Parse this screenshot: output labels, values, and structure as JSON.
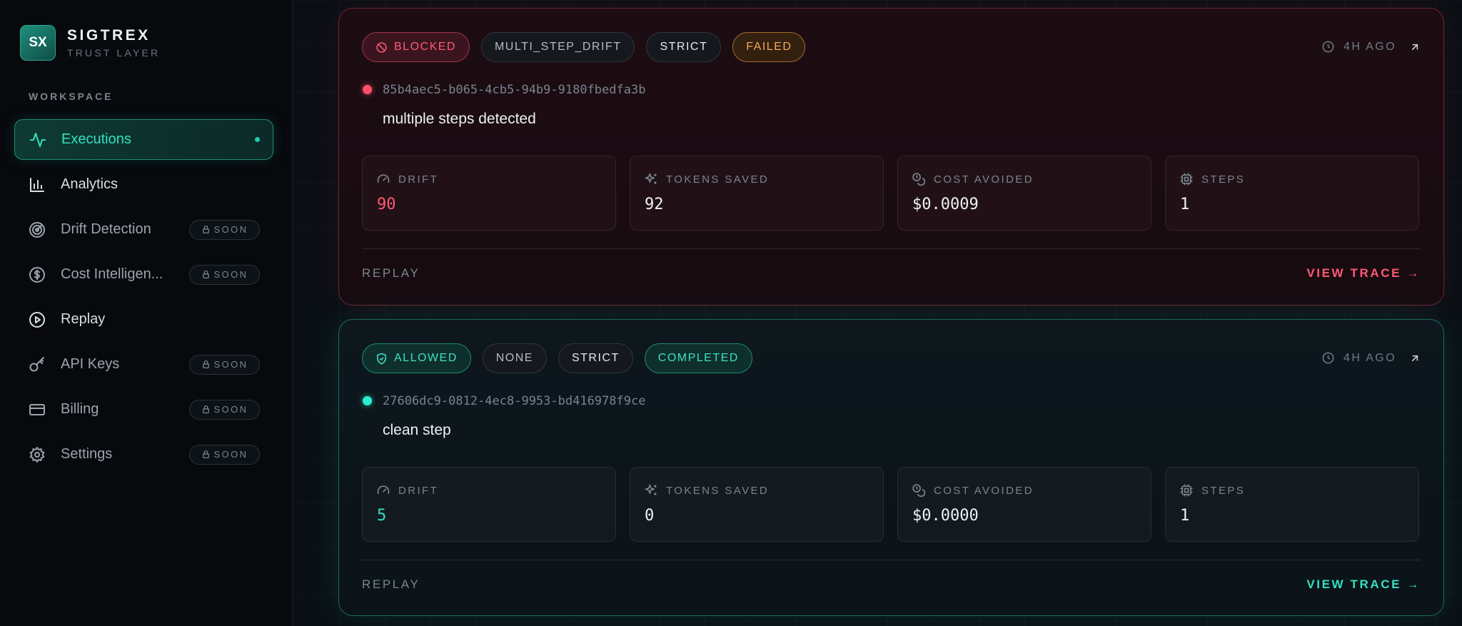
{
  "brand": {
    "logo": "SX",
    "name": "SIGTREX",
    "subtitle": "TRUST LAYER"
  },
  "sidebar": {
    "section_label": "WORKSPACE",
    "items": [
      {
        "label": "Executions",
        "icon": "activity-icon",
        "active": true
      },
      {
        "label": "Analytics",
        "icon": "bar-chart-icon"
      },
      {
        "label": "Drift Detection",
        "icon": "radar-icon",
        "badge": "SOON"
      },
      {
        "label": "Cost Intelligen...",
        "icon": "dollar-circle-icon",
        "badge": "SOON"
      },
      {
        "label": "Replay",
        "icon": "play-circle-icon"
      },
      {
        "label": "API Keys",
        "icon": "key-icon",
        "badge": "SOON"
      },
      {
        "label": "Billing",
        "icon": "credit-card-icon",
        "badge": "SOON"
      },
      {
        "label": "Settings",
        "icon": "gear-icon",
        "badge": "SOON"
      }
    ]
  },
  "executions": [
    {
      "status": "BLOCKED",
      "drift_type": "MULTI_STEP_DRIFT",
      "mode": "STRICT",
      "result": "FAILED",
      "time": "4H AGO",
      "id": "85b4aec5-b065-4cb5-94b9-9180fbedfa3b",
      "message": "multiple steps detected",
      "metrics": {
        "drift_label": "DRIFT",
        "drift": "90",
        "tokens_label": "TOKENS SAVED",
        "tokens": "92",
        "cost_label": "COST AVOIDED",
        "cost": "$0.0009",
        "steps_label": "STEPS",
        "steps": "1"
      },
      "replay": "REPLAY",
      "view_trace": "VIEW TRACE →",
      "accent": "#ff5a74"
    },
    {
      "status": "ALLOWED",
      "drift_type": "NONE",
      "mode": "STRICT",
      "result": "COMPLETED",
      "time": "4H AGO",
      "id": "27606dc9-0812-4ec8-9953-bd416978f9ce",
      "message": "clean step",
      "metrics": {
        "drift_label": "DRIFT",
        "drift": "5",
        "tokens_label": "TOKENS SAVED",
        "tokens": "0",
        "cost_label": "COST AVOIDED",
        "cost": "$0.0000",
        "steps_label": "STEPS",
        "steps": "1"
      },
      "replay": "REPLAY",
      "view_trace": "VIEW TRACE →",
      "accent": "#35e0c0"
    }
  ]
}
